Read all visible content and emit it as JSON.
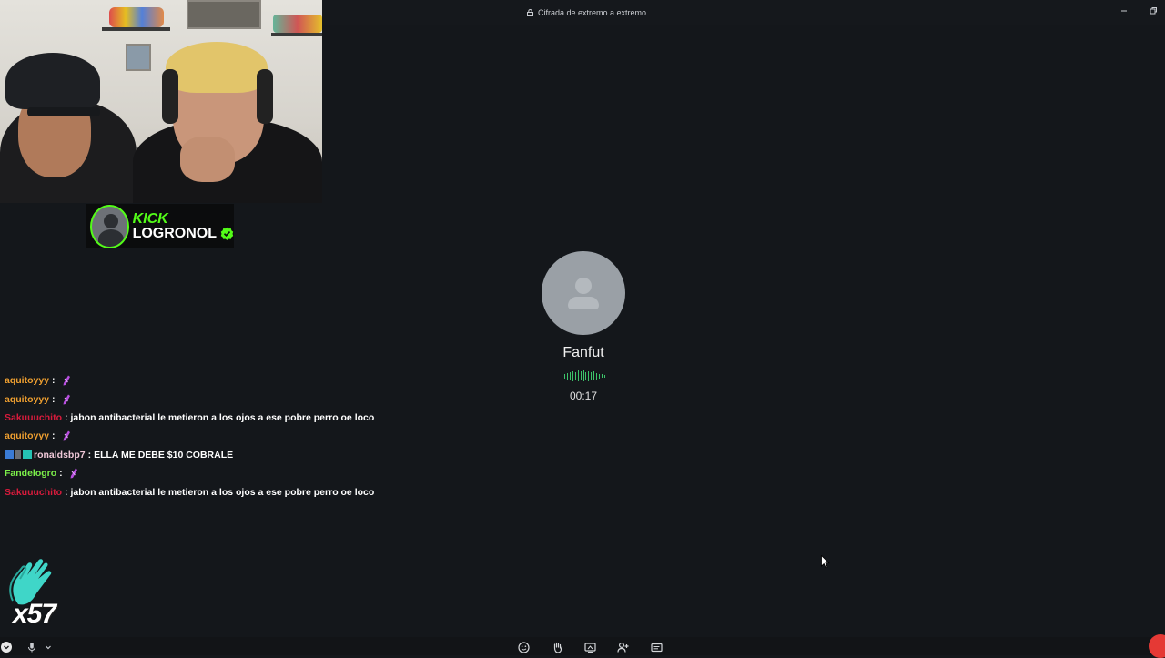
{
  "titlebar": {
    "encryption_label": "Cifrada de extremo a extremo"
  },
  "stream_overlay": {
    "kick": {
      "brand": "KICK",
      "channel": "LOGRONOL",
      "brand_color": "#53fc18"
    }
  },
  "call": {
    "contact_name": "Fanfut",
    "duration": "00:17",
    "waveform_color": "#3cc46a"
  },
  "chat": {
    "messages": [
      {
        "user": "aquitoyyy",
        "sep": ":",
        "text": "",
        "user_color": "#f0a030",
        "emote": "purple-emote"
      },
      {
        "user": "aquitoyyy",
        "sep": ":",
        "text": "",
        "user_color": "#f0a030",
        "emote": "purple-emote"
      },
      {
        "user": "Sakuuuchito",
        "sep": ":",
        "text": "jabon antibacterial le metieron a los ojos a ese pobre perro oe loco",
        "user_color": "#d81b3c"
      },
      {
        "user": "aquitoyyy",
        "sep": ":",
        "text": "",
        "user_color": "#f0a030",
        "emote": "purple-emote"
      },
      {
        "user": "ronaldsbp7",
        "sep": ":",
        "text": "ELLA ME DEBE $10 COBRALE",
        "user_color": "#f0c8d8",
        "badges": true
      },
      {
        "user": "Fandelogro",
        "sep": ":",
        "text": "",
        "user_color": "#7cf04a",
        "emote": "purple-emote"
      },
      {
        "user": "Sakuuuchito",
        "sep": ":",
        "text": "jabon antibacterial le metieron a los ojos a ese pobre perro oe loco",
        "user_color": "#d81b3c"
      }
    ]
  },
  "emote_combo": {
    "count": "x57",
    "icon": "clapping-hands-icon",
    "color": "#3fd6c8"
  },
  "bottom_bar": {
    "icons": [
      "microphone-icon",
      "chevron-down-icon",
      "emoji-icon",
      "raise-hand-icon",
      "screen-share-icon",
      "add-person-icon",
      "captions-icon"
    ]
  }
}
